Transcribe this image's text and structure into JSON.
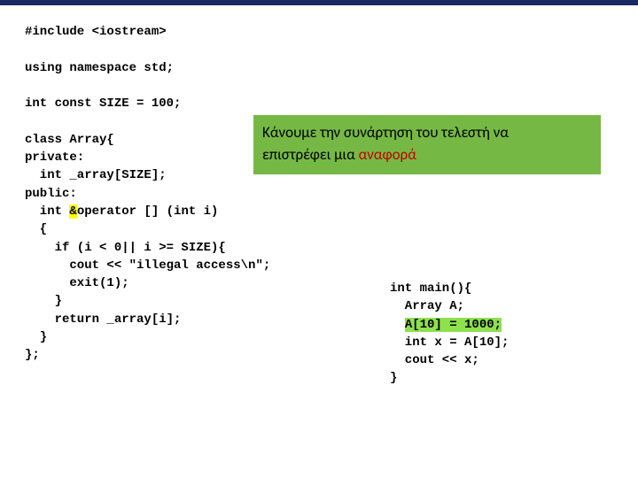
{
  "code_main": {
    "l01": "#include <iostream>",
    "l02": "using namespace std;",
    "l03": "int const SIZE = 100;",
    "l04": "class Array{",
    "l05": "private:",
    "l06": "  int _array[SIZE];",
    "l07": "public:",
    "l08_a": "  int ",
    "l08_b": "&",
    "l08_c": "operator [] (int i)",
    "l09": "  {",
    "l10": "    if (i < 0|| i >= SIZE){",
    "l11": "      cout << \"illegal access\\n\";",
    "l12": "      exit(1);",
    "l13": "    }",
    "l14": "    return _array[i];",
    "l15": "  }",
    "l16": "};"
  },
  "code_snippet": {
    "s01": "int main(){",
    "s02": "  Array A;",
    "s03_a": "  ",
    "s03_b": "A[10] = 1000;",
    "s04": "  int x = A[10];",
    "s05": "  cout << x;",
    "s06": "}"
  },
  "callout": {
    "line1": "Κάνουμε την συνάρτηση του τελεστή να",
    "line2a": "επιστρέφει μια ",
    "line2b": "αναφορά"
  }
}
